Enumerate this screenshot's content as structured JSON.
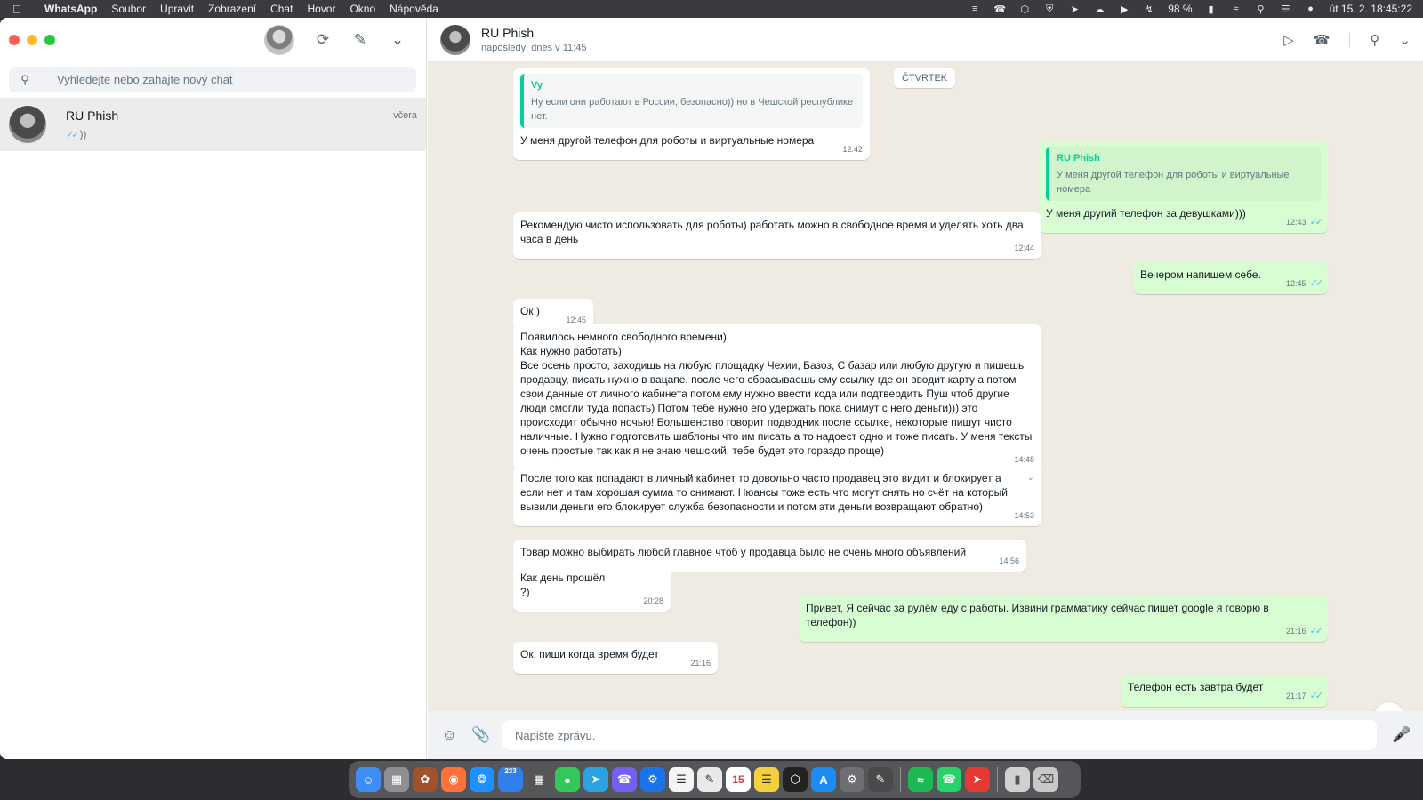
{
  "menubar": {
    "app_name": "WhatsApp",
    "menus": [
      "Soubor",
      "Upravit",
      "Zobrazení",
      "Chat",
      "Hovor",
      "Okno",
      "Nápověda"
    ],
    "battery": "98 %",
    "datetime": "út 15. 2.  18:45:22"
  },
  "sidebar": {
    "search_placeholder": "Vyhledejte nebo zahajte nový chat",
    "chats": [
      {
        "name": "RU Phish",
        "time": "včera",
        "last_message": "))"
      }
    ]
  },
  "chat": {
    "contact_name": "RU Phish",
    "status": "naposledy: dnes v 11:45",
    "date_chip": "ČTVRTEK",
    "messages": [
      {
        "dir": "in",
        "quote_author": "Vy",
        "quote_text": "Ну если они работают в России, безопасно)) но в Чешской республике нет.",
        "text": "У меня другой телефон для роботы и виртуальные номера",
        "time": "12:42"
      },
      {
        "dir": "out",
        "quote_author": "RU Phish",
        "quote_text": "У меня другой телефон для роботы и виртуальные номера",
        "text": "У меня другий телефон за девушками)))",
        "time": "12:43"
      },
      {
        "dir": "in",
        "text": "Рекомендую чисто использовать для роботы) работать можно в свободное время и уделять хоть два часа в день",
        "time": "12:44"
      },
      {
        "dir": "out",
        "text": "Вечером напишем себе.",
        "time": "12:45"
      },
      {
        "dir": "in",
        "text": "Ок )",
        "time": "12:45"
      },
      {
        "dir": "in",
        "text": "Появилось немного свободного времени)\nКак нужно работать)\nВсе осень просто, заходишь на любую площадку Чехии, Базоз, С базар или  любую другую и пишешь продавцу, писать нужно в вацапе. после чего сбрасываешь ему ссылку где он вводит карту а потом свои данные от личного кабинета потом ему нужно ввести кода или подтвердить Пуш чтоб другие люди смогли туда попасть) Потом тебе нужно его удержать пока снимут с него деньги))) это происходит обычно ночью! Большенство говорит подводник после ссылке, некоторые пишут чисто наличные. Нужно подготовить шаблоны что им писать а то надоест одно и тоже писать. У меня тексты очень простые так как я не знаю чешский, тебе будет это гораздо проще)",
        "time": "14:48"
      },
      {
        "dir": "in",
        "text": "После того как попадают в личный кабинет то довольно часто продавец это видит и блокирует а если нет и там хорошая сумма то снимают. Нюансы тоже есть что могут снять но счёт на который вывили деньги его блокирует служба безопасности и потом эти деньги возвращают обратно)",
        "time": "14:53"
      },
      {
        "dir": "in",
        "text": "Товар можно выбирать любой главное чтоб у продавца было не очень много объявлений",
        "time": "14:56"
      },
      {
        "dir": "in",
        "text": "Как день прошёл ?)",
        "time": "20:28"
      },
      {
        "dir": "out",
        "text": "Привет, Я сейчас за рулём еду с работы. Извини грамматику сейчас пишет google я говорю в телефон))",
        "time": "21:16"
      },
      {
        "dir": "in",
        "text": "Ок, пиши когда время будет",
        "time": "21:16"
      },
      {
        "dir": "out",
        "text": "Телефон есть завтра будет",
        "time": "21:17"
      }
    ]
  },
  "composer": {
    "placeholder": "Napište zprávu."
  },
  "dock": {
    "calendar_day": "15",
    "mail_badge": "233"
  },
  "colors": {
    "accent": "#06cf9c",
    "outgoing_bubble": "#d9fdd3",
    "read_ticks": "#53bdeb",
    "chat_background": "#efeae2"
  }
}
